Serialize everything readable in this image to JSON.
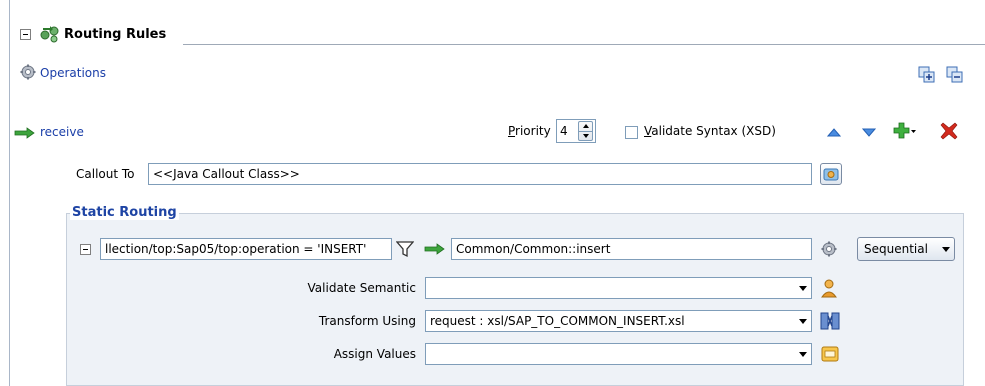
{
  "header": {
    "title": "Routing Rules"
  },
  "operations": {
    "label": "Operations"
  },
  "rule": {
    "operation_name": "receive",
    "priority_label": "Priority",
    "priority_value": "4",
    "validate_syntax_label": "Validate Syntax (XSD)"
  },
  "callout": {
    "label": "Callout To",
    "value": "<<Java Callout Class>>"
  },
  "static_routing": {
    "title": "Static Routing",
    "filter_expression": "llection/top:Sap05/top:operation = 'INSERT'",
    "target": "Common/Common::insert",
    "execution": "Sequential",
    "validate_semantic_label": "Validate Semantic",
    "validate_semantic_value": "",
    "transform_using_label": "Transform Using",
    "transform_using_value": "request : xsl/SAP_TO_COMMON_INSERT.xsl",
    "assign_values_label": "Assign Values",
    "assign_values_value": ""
  },
  "icons": {
    "routing": "routing-rules-icon",
    "operations": "gear-icon",
    "expand_all": "expand-all-icon",
    "collapse_all": "collapse-all-icon",
    "move_up": "triangle-up-icon",
    "move_down": "triangle-down-icon",
    "add": "green-plus-icon",
    "delete": "red-x-icon",
    "filter": "funnel-icon",
    "arrow": "green-arrow-icon"
  },
  "colors": {
    "link": "#1a3ea8",
    "group_title": "#1e44a4",
    "group_bg": "#eef2f7",
    "add_green": "#2e9e2e",
    "delete_red": "#d22a1e"
  }
}
